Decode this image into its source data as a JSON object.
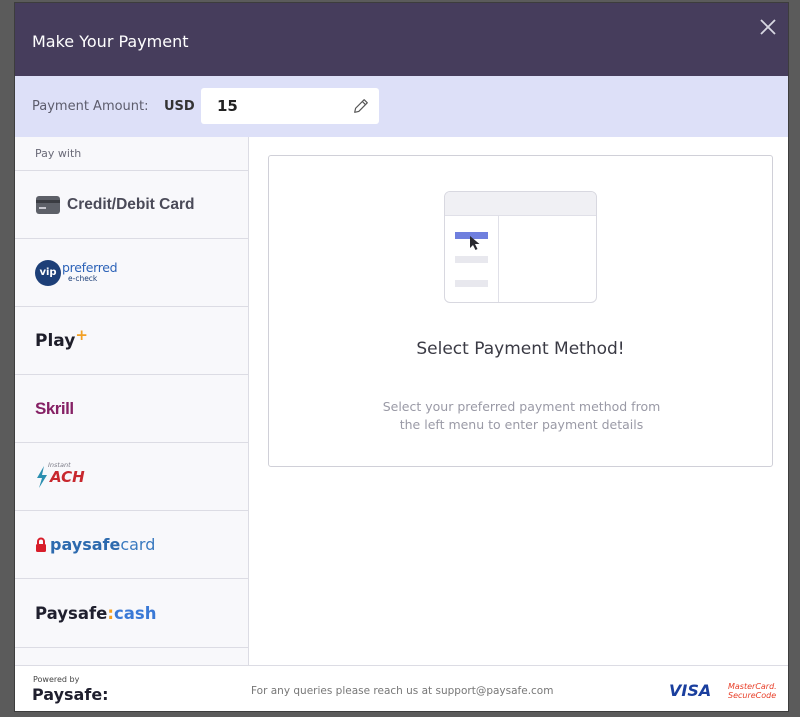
{
  "header": {
    "title": "Make Your Payment"
  },
  "amount": {
    "label": "Payment Amount:",
    "currency": "USD",
    "value": "15"
  },
  "sidebar": {
    "heading": "Pay with",
    "methods": [
      {
        "label": "Credit/Debit Card",
        "icon": "credit-card-icon"
      },
      {
        "label_a": "vip",
        "label_b": "preferred",
        "label_c": "e-check",
        "icon": "vip-preferred-logo"
      },
      {
        "label_a": "Play",
        "label_b": "+",
        "icon": "play-plus-logo"
      },
      {
        "label": "Skrill",
        "icon": "skrill-logo"
      },
      {
        "label_a": "Instant",
        "label_b": "ACH",
        "icon": "instant-ach-logo"
      },
      {
        "label_a": "paysafe",
        "label_b": "card",
        "icon": "paysafecard-logo"
      },
      {
        "label_a": "Paysafe",
        "label_b": ":",
        "label_c": "cash",
        "icon": "paysafecash-logo"
      }
    ]
  },
  "main": {
    "title": "Select Payment Method!",
    "desc_line1": "Select your preferred payment method from",
    "desc_line2": "the left menu to enter payment details"
  },
  "footer": {
    "powered_by": "Powered by",
    "brand": "Paysafe:",
    "support_text": "For any queries please reach us at support@paysafe.com",
    "visa": "VISA",
    "mastercard_line1": "MasterCard.",
    "mastercard_line2": "SecureCode"
  },
  "colors": {
    "header_bg": "#463d5c",
    "amount_bar_bg": "#dde0f8",
    "accent": "#6f7fde",
    "skrill": "#862165",
    "paysafecard_red": "#d81e2a",
    "paysafecard_blue": "#2d6aae",
    "paysafecash_blue": "#3a79d6"
  }
}
